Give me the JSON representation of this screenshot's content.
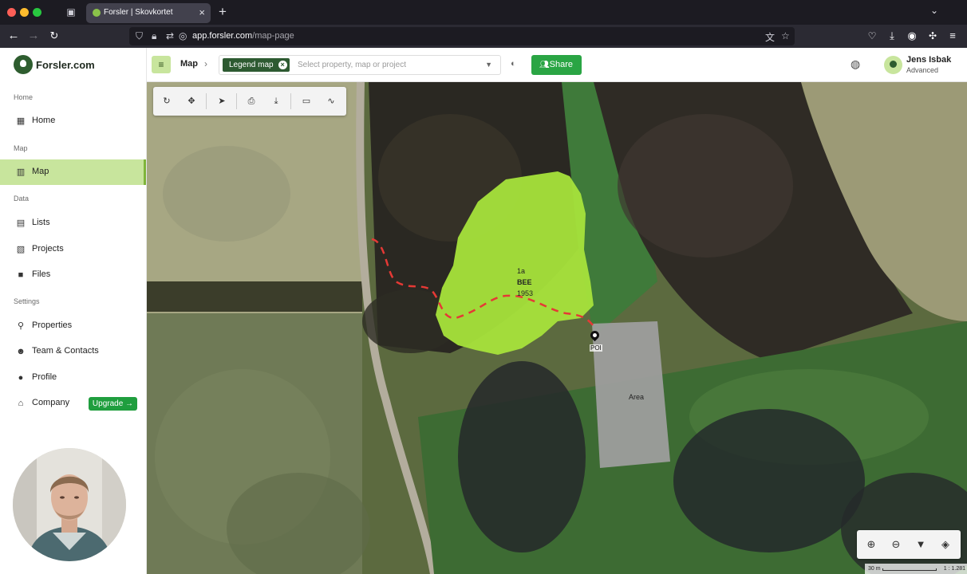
{
  "browser": {
    "tab_title": "Forsler | Skovkortet",
    "url_host": "app.forsler.com",
    "url_path": "/map-page"
  },
  "sidebar": {
    "logo": "Forsler.com",
    "sections": [
      {
        "label": "Home",
        "items": [
          {
            "label": "Home",
            "icon": "dashboard-icon"
          }
        ]
      },
      {
        "label": "Map",
        "items": [
          {
            "label": "Map",
            "icon": "map-icon",
            "active": true
          }
        ]
      },
      {
        "label": "Data",
        "items": [
          {
            "label": "Lists",
            "icon": "table-icon"
          },
          {
            "label": "Projects",
            "icon": "clipboard-icon"
          },
          {
            "label": "Files",
            "icon": "folder-icon"
          }
        ]
      },
      {
        "label": "Settings",
        "items": [
          {
            "label": "Properties",
            "icon": "pin-icon"
          },
          {
            "label": "Team & Contacts",
            "icon": "team-icon"
          },
          {
            "label": "Profile",
            "icon": "profile-icon"
          },
          {
            "label": "Company",
            "icon": "home-icon"
          }
        ]
      }
    ],
    "upgrade_label": "Upgrade →"
  },
  "header": {
    "breadcrumb": "Map",
    "chip_label": "Legend map",
    "selector_placeholder": "Select property, map or project",
    "share_label": "Share",
    "user_name": "Jens Isbak",
    "user_level": "Advanced"
  },
  "map": {
    "stand": {
      "number": "1a",
      "species": "BEE",
      "year": "1953",
      "fill": "#a6e33b"
    },
    "poi_label": "POI",
    "area_label": "Area",
    "trail_color": "#e53935",
    "scale_distance": "30 m",
    "scale_ratio": "1 : 1.281"
  },
  "colors": {
    "accent": "#2aa544",
    "nav_active": "#c8e59d",
    "brand_dark": "#2d5a31"
  }
}
